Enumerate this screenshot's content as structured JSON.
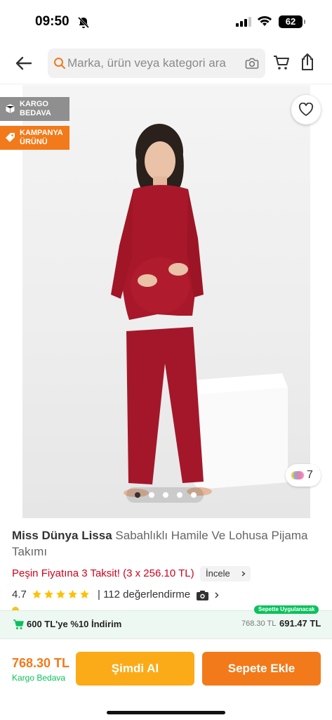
{
  "status_bar": {
    "time": "09:50",
    "battery": "62"
  },
  "header": {
    "search_placeholder": "Marka, ürün veya kategori ara"
  },
  "gallery": {
    "badges": [
      {
        "label": "KARGO BEDAVA",
        "icon": "box-icon",
        "color": "#8f8f8f"
      },
      {
        "label": "KAMPANYA ÜRÜNÜ",
        "icon": "tag-icon",
        "color": "#f27a1a"
      }
    ],
    "variant_count": "7",
    "dot_count": 5,
    "active_dot": 0
  },
  "product": {
    "brand": "Miss Dünya Lissa",
    "name": "Sabahlıklı Hamile Ve Lohusa Pijama Takımı",
    "installment": "Peşin Fiyatına 3 Taksit! (3 x 256.10 TL)",
    "installment_link": "İncele",
    "rating": "4.7",
    "stars": 5,
    "reviews": "| 112 değerlendirme"
  },
  "promo": {
    "badge": "Sepette Uygulanacak",
    "text": "600 TL'ye %10 İndirim",
    "old_price": "768.30 TL",
    "new_price": "691.47 TL"
  },
  "footer": {
    "price": "768.30 TL",
    "shipping": "Kargo Bedava",
    "buy_label": "Şimdi Al",
    "cart_label": "Sepete Ekle"
  },
  "colors": {
    "accent": "#f27a1a",
    "buy_now": "#fbab18",
    "discount_red": "#d0021b",
    "success_green": "#0bc15c"
  }
}
